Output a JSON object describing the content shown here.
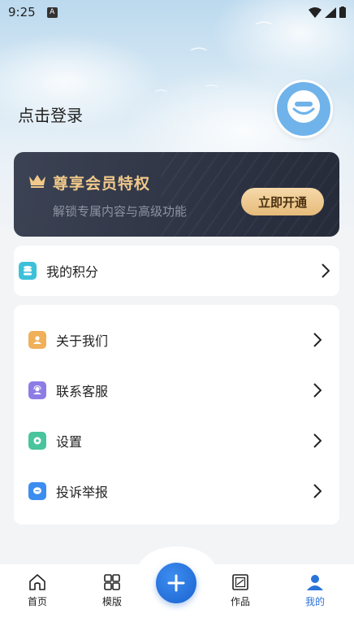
{
  "status_bar": {
    "time": "9:25",
    "notification_badge": "A"
  },
  "profile": {
    "login_text": "点击登录"
  },
  "vip": {
    "title": "尊享会员特权",
    "subtitle": "解锁专属内容与高级功能",
    "button": "立即开通",
    "accent_color": "#f1c98b"
  },
  "points": {
    "label": "我的积分",
    "icon": "database-icon",
    "icon_color": "#3ec0d9"
  },
  "menu": [
    {
      "label": "关于我们",
      "icon": "user-card-icon",
      "color": "#f0b05a"
    },
    {
      "label": "联系客服",
      "icon": "service-icon",
      "color": "#8e7ce6"
    },
    {
      "label": "设置",
      "icon": "gear-icon",
      "color": "#49c49d"
    },
    {
      "label": "投诉举报",
      "icon": "chat-icon",
      "color": "#3d8df0"
    }
  ],
  "bottom_nav": {
    "items": [
      {
        "label": "首页",
        "icon": "home-icon"
      },
      {
        "label": "模版",
        "icon": "grid-icon"
      },
      {
        "label": "作品",
        "icon": "artwork-icon"
      },
      {
        "label": "我的",
        "icon": "person-icon",
        "active": true
      }
    ],
    "active_color": "#2a73d9"
  }
}
